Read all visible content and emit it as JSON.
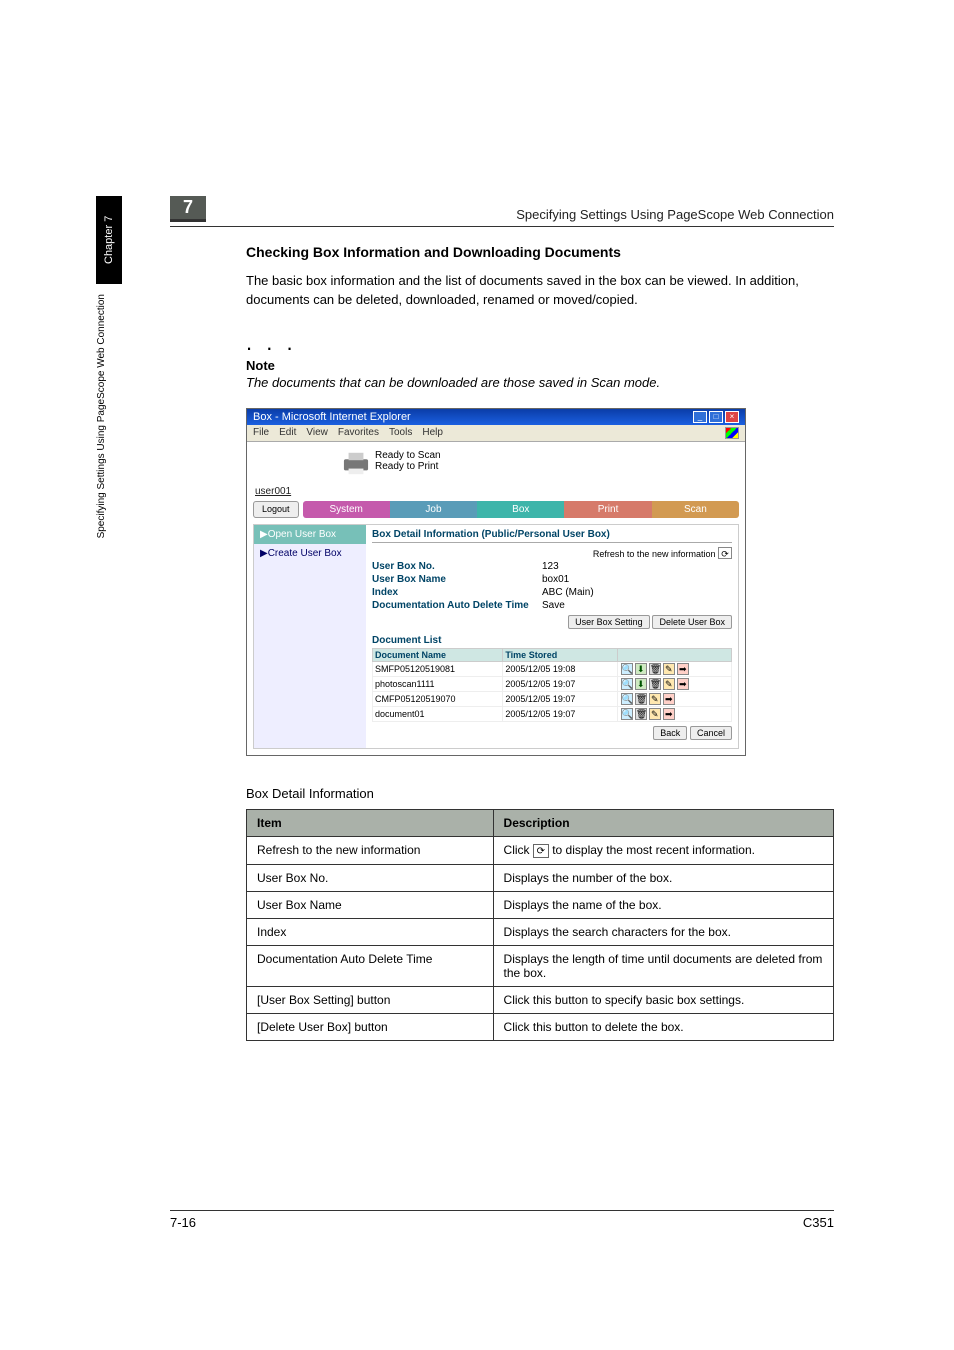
{
  "sideTab": {
    "upper": "Chapter 7",
    "lower": "Specifying Settings Using PageScope Web Connection"
  },
  "header": {
    "chapterNumber": "7",
    "runningTitle": "Specifying Settings Using PageScope Web Connection"
  },
  "section": {
    "title": "Checking Box Information and Downloading Documents",
    "body": "The basic box information and the list of documents saved in the box can be viewed. In addition, documents can be deleted, downloaded, renamed or moved/copied."
  },
  "note": {
    "heading": "Note",
    "text": "The documents that can be downloaded are those saved in Scan mode."
  },
  "screenshot": {
    "windowTitle": "Box - Microsoft Internet Explorer",
    "menubar": [
      "File",
      "Edit",
      "View",
      "Favorites",
      "Tools",
      "Help"
    ],
    "status": {
      "line1": "Ready to Scan",
      "line2": "Ready to Print"
    },
    "userLabel": "user001",
    "logoutLabel": "Logout",
    "tabs": {
      "system": "System",
      "job": "Job",
      "box": "Box",
      "print": "Print",
      "scan": "Scan"
    },
    "leftNav": {
      "open": "▶Open User Box",
      "create": "▶Create User Box"
    },
    "detail": {
      "heading": "Box Detail Information (Public/Personal User Box)",
      "refreshLabel": "Refresh to the new information",
      "rows": {
        "userBoxNo": {
          "label": "User Box No.",
          "value": "123"
        },
        "userBoxName": {
          "label": "User Box Name",
          "value": "box01"
        },
        "index": {
          "label": "Index",
          "value": "ABC  (Main)"
        },
        "autoDelete": {
          "label": "Documentation Auto Delete Time",
          "value": "Save"
        }
      },
      "setButton": "User Box Setting",
      "deleteButton": "Delete User Box"
    },
    "docList": {
      "title": "Document List",
      "colDoc": "Document Name",
      "colTime": "Time Stored",
      "rows": [
        {
          "name": "SMFP05120519081",
          "time": "2005/12/05 19:08",
          "dl": true
        },
        {
          "name": "photoscan1111",
          "time": "2005/12/05 19:07",
          "dl": true
        },
        {
          "name": "CMFP05120519070",
          "time": "2005/12/05 19:07",
          "dl": false
        },
        {
          "name": "document01",
          "time": "2005/12/05 19:07",
          "dl": false
        }
      ],
      "backButton": "Back",
      "cancelButton": "Cancel"
    }
  },
  "tableTitle": "Box Detail Information",
  "table": {
    "headItem": "Item",
    "headDesc": "Description",
    "rows": {
      "refresh": {
        "item": "Refresh to the new information",
        "descPre": "Click ",
        "descPost": " to display the most recent information."
      },
      "boxNo": {
        "item": "User Box No.",
        "desc": "Displays the number of the box."
      },
      "boxName": {
        "item": "User Box Name",
        "desc": "Displays the name of the box."
      },
      "index": {
        "item": "Index",
        "desc": "Displays the search characters for the box."
      },
      "autoDel": {
        "item": "Documentation Auto Delete Time",
        "desc": "Displays the length of time until documents are deleted from the box."
      },
      "setBtn": {
        "item": "[User Box Setting] button",
        "desc": "Click this button to specify basic box settings."
      },
      "delBtn": {
        "item": "[Delete User Box] button",
        "desc": "Click this button to delete the box."
      }
    }
  },
  "footer": {
    "pageNumber": "7-16",
    "model": "C351"
  }
}
